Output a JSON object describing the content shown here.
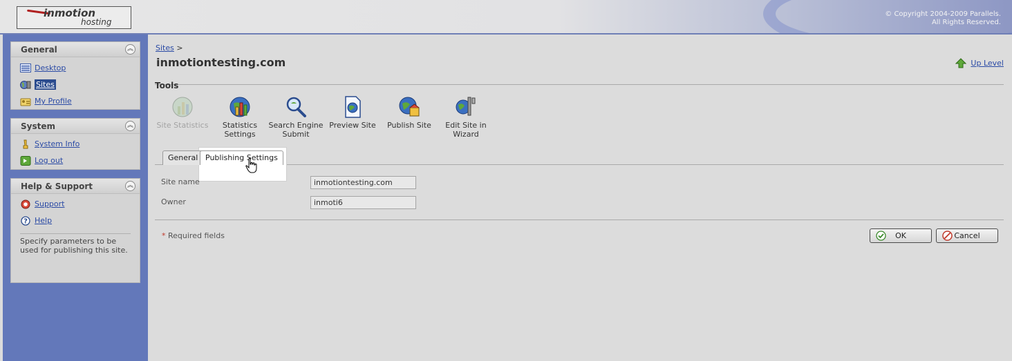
{
  "header": {
    "logo_brand": "inmotion",
    "logo_sub": "hosting",
    "copyright_line1": "© Copyright 2004-2009 Parallels.",
    "copyright_line2": "All Rights Reserved."
  },
  "sidebar": {
    "general": {
      "title": "General",
      "items": [
        {
          "label": "Desktop",
          "icon": "desktop-icon"
        },
        {
          "label": "Sites",
          "icon": "sites-icon",
          "active": true
        },
        {
          "label": "My Profile",
          "icon": "profile-icon"
        }
      ]
    },
    "system": {
      "title": "System",
      "items": [
        {
          "label": "System Info",
          "icon": "system-info-icon"
        },
        {
          "label": "Log out",
          "icon": "logout-icon"
        }
      ]
    },
    "help": {
      "title": "Help & Support",
      "items": [
        {
          "label": "Support",
          "icon": "support-icon"
        },
        {
          "label": "Help",
          "icon": "help-icon"
        }
      ],
      "description": "Specify parameters to be used for publishing this site."
    }
  },
  "main": {
    "breadcrumb_link": "Sites",
    "breadcrumb_sep": ">",
    "title": "inmotiontesting.com",
    "up_level": "Up Level",
    "tools_title": "Tools",
    "tools": [
      {
        "label": "Site Statistics",
        "icon": "site-statistics-icon",
        "disabled": true
      },
      {
        "label": "Statistics Settings",
        "icon": "statistics-settings-icon"
      },
      {
        "label": "Search Engine Submit",
        "icon": "search-engine-submit-icon"
      },
      {
        "label": "Preview Site",
        "icon": "preview-site-icon"
      },
      {
        "label": "Publish Site",
        "icon": "publish-site-icon"
      },
      {
        "label": "Edit Site in Wizard",
        "icon": "edit-site-wizard-icon"
      }
    ],
    "tabs": [
      {
        "label": "General"
      },
      {
        "label": "Publishing Settings",
        "hovered": true
      }
    ],
    "form": {
      "site_name_label": "Site name",
      "site_name_value": "inmotiontesting.com",
      "owner_label": "Owner",
      "owner_value": "inmoti6"
    },
    "required_star": "*",
    "required_text": "Required fields",
    "ok_label": "OK",
    "cancel_label": "Cancel"
  },
  "colors": {
    "sidebar_bg": "#6378ba",
    "link": "#2a4aa5",
    "active_nav": "#2b4c8e"
  }
}
